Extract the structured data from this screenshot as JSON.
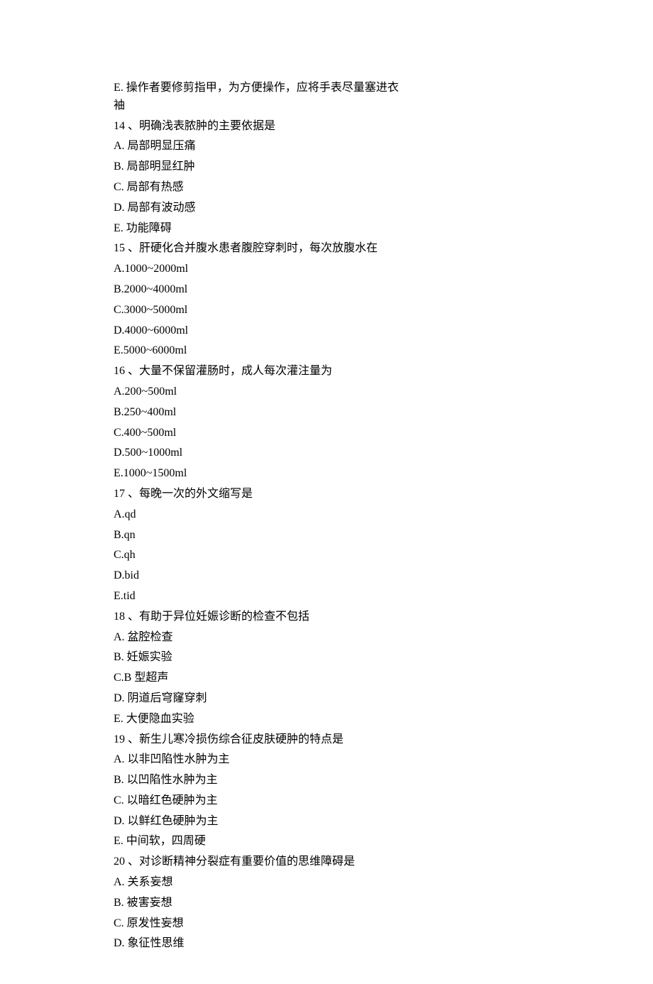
{
  "lines": [
    "E. 操作者要修剪指甲，为方便操作，应将手表尽量塞进衣袖",
    "14 、明确浅表脓肿的主要依据是",
    "A. 局部明显压痛",
    "B. 局部明显红肿",
    "C. 局部有热感",
    "D. 局部有波动感",
    "E. 功能障碍",
    "15 、肝硬化合并腹水患者腹腔穿刺时，每次放腹水在",
    "A.1000~2000ml",
    "B.2000~4000ml",
    "C.3000~5000ml",
    "D.4000~6000ml",
    "E.5000~6000ml",
    "16 、大量不保留灌肠时，成人每次灌注量为",
    "A.200~500ml",
    "B.250~400ml",
    "C.400~500ml",
    "D.500~1000ml",
    "E.1000~1500ml",
    "17 、每晚一次的外文缩写是",
    "A.qd",
    "B.qn",
    "C.qh",
    "D.bid",
    "E.tid",
    "18 、有助于异位妊娠诊断的检查不包括",
    "A. 盆腔检查",
    "B. 妊娠实验",
    "C.B 型超声",
    "D. 阴道后穹窿穿刺",
    "E. 大便隐血实验",
    "19 、新生儿寒冷损伤综合征皮肤硬肿的特点是",
    "A. 以非凹陷性水肿为主",
    "B. 以凹陷性水肿为主",
    "C. 以暗红色硬肿为主",
    "D. 以鲜红色硬肿为主",
    "E. 中间软，四周硬",
    "20 、对诊断精神分裂症有重要价值的思维障碍是",
    "A. 关系妄想",
    "B. 被害妄想",
    "C. 原发性妄想",
    "D. 象征性思维"
  ]
}
